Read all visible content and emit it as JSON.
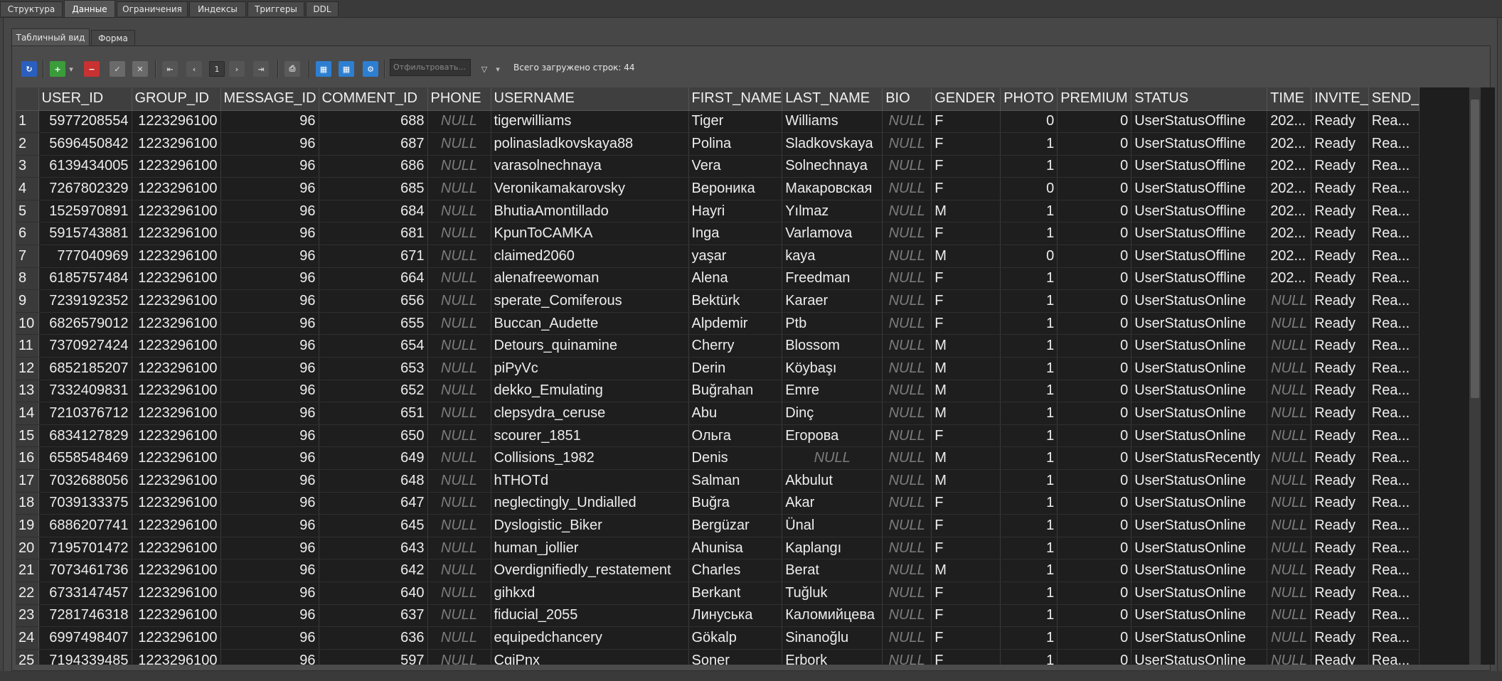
{
  "top_tabs": [
    "Структура",
    "Данные",
    "Ограничения",
    "Индексы",
    "Триггеры",
    "DDL"
  ],
  "sub_tabs": [
    "Табличный вид",
    "Форма"
  ],
  "toolbar": {
    "page_number": "1",
    "filter_placeholder": "Отфильтровать...",
    "row_count_label": "Всего загружено строк: 44"
  },
  "colors": {
    "background": "#434343",
    "grid_bg": "#1e1e1e",
    "header_bg": "#3f3f3f",
    "null_text": "#7d7d7d"
  },
  "grid": {
    "columns": [
      "USER_ID",
      "GROUP_ID",
      "MESSAGE_ID",
      "COMMENT_ID",
      "PHONE",
      "USERNAME",
      "FIRST_NAME",
      "LAST_NAME",
      "BIO",
      "GENDER",
      "PHOTO",
      "PREMIUM",
      "STATUS",
      "TIME",
      "INVITE_",
      "SEND_"
    ],
    "rows": [
      [
        "1",
        "5977208554",
        "1223296100",
        "96",
        "688",
        "NULL",
        "tigerwilliams",
        "Tiger",
        "Williams",
        "NULL",
        "F",
        "0",
        "0",
        "UserStatusOffline",
        "202...",
        "Ready",
        "Rea..."
      ],
      [
        "2",
        "5696450842",
        "1223296100",
        "96",
        "687",
        "NULL",
        "polinasladkovskaya88",
        "Polina",
        "Sladkovskaya",
        "NULL",
        "F",
        "1",
        "0",
        "UserStatusOffline",
        "202...",
        "Ready",
        "Rea..."
      ],
      [
        "3",
        "6139434005",
        "1223296100",
        "96",
        "686",
        "NULL",
        "varasolnechnaya",
        "Vera",
        "Solnechnaya",
        "NULL",
        "F",
        "1",
        "0",
        "UserStatusOffline",
        "202...",
        "Ready",
        "Rea..."
      ],
      [
        "4",
        "7267802329",
        "1223296100",
        "96",
        "685",
        "NULL",
        "Veronikamakarovsky",
        "Вероника",
        "Макаровская",
        "NULL",
        "F",
        "0",
        "0",
        "UserStatusOffline",
        "202...",
        "Ready",
        "Rea..."
      ],
      [
        "5",
        "1525970891",
        "1223296100",
        "96",
        "684",
        "NULL",
        "BhutiaAmontillado",
        "Hayri",
        "Yılmaz",
        "NULL",
        "M",
        "1",
        "0",
        "UserStatusOffline",
        "202...",
        "Ready",
        "Rea..."
      ],
      [
        "6",
        "5915743881",
        "1223296100",
        "96",
        "681",
        "NULL",
        "KpunToCAMKA",
        "Inga",
        "Varlamova",
        "NULL",
        "F",
        "1",
        "0",
        "UserStatusOffline",
        "202...",
        "Ready",
        "Rea..."
      ],
      [
        "7",
        "777040969",
        "1223296100",
        "96",
        "671",
        "NULL",
        "claimed2060",
        "yaşar",
        "kaya",
        "NULL",
        "M",
        "0",
        "0",
        "UserStatusOffline",
        "202...",
        "Ready",
        "Rea..."
      ],
      [
        "8",
        "6185757484",
        "1223296100",
        "96",
        "664",
        "NULL",
        "alenafreewoman",
        "Alena",
        "Freedman",
        "NULL",
        "F",
        "1",
        "0",
        "UserStatusOffline",
        "202...",
        "Ready",
        "Rea..."
      ],
      [
        "9",
        "7239192352",
        "1223296100",
        "96",
        "656",
        "NULL",
        "sperate_Comiferous",
        "Bektürk",
        "Karaer",
        "NULL",
        "F",
        "1",
        "0",
        "UserStatusOnline",
        "NULL",
        "Ready",
        "Rea..."
      ],
      [
        "10",
        "6826579012",
        "1223296100",
        "96",
        "655",
        "NULL",
        "Buccan_Audette",
        "Alpdemir",
        "Ptb",
        "NULL",
        "F",
        "1",
        "0",
        "UserStatusOnline",
        "NULL",
        "Ready",
        "Rea..."
      ],
      [
        "11",
        "7370927424",
        "1223296100",
        "96",
        "654",
        "NULL",
        "Detours_quinamine",
        "Cherry",
        "Blossom",
        "NULL",
        "M",
        "1",
        "0",
        "UserStatusOnline",
        "NULL",
        "Ready",
        "Rea..."
      ],
      [
        "12",
        "6852185207",
        "1223296100",
        "96",
        "653",
        "NULL",
        "piPyVc",
        "Derin",
        "Köybaşı",
        "NULL",
        "M",
        "1",
        "0",
        "UserStatusOnline",
        "NULL",
        "Ready",
        "Rea..."
      ],
      [
        "13",
        "7332409831",
        "1223296100",
        "96",
        "652",
        "NULL",
        "dekko_Emulating",
        "Buğrahan",
        "Emre",
        "NULL",
        "M",
        "1",
        "0",
        "UserStatusOnline",
        "NULL",
        "Ready",
        "Rea..."
      ],
      [
        "14",
        "7210376712",
        "1223296100",
        "96",
        "651",
        "NULL",
        "clepsydra_ceruse",
        "Abu",
        "Dinç",
        "NULL",
        "M",
        "1",
        "0",
        "UserStatusOnline",
        "NULL",
        "Ready",
        "Rea..."
      ],
      [
        "15",
        "6834127829",
        "1223296100",
        "96",
        "650",
        "NULL",
        "scourer_1851",
        "Ольга",
        "Егорова",
        "NULL",
        "F",
        "1",
        "0",
        "UserStatusOnline",
        "NULL",
        "Ready",
        "Rea..."
      ],
      [
        "16",
        "6558548469",
        "1223296100",
        "96",
        "649",
        "NULL",
        "Collisions_1982",
        "Denis",
        "NULL",
        "NULL",
        "M",
        "1",
        "0",
        "UserStatusRecently",
        "NULL",
        "Ready",
        "Rea..."
      ],
      [
        "17",
        "7032688056",
        "1223296100",
        "96",
        "648",
        "NULL",
        "hTHOTd",
        "Salman",
        "Akbulut",
        "NULL",
        "M",
        "1",
        "0",
        "UserStatusOnline",
        "NULL",
        "Ready",
        "Rea..."
      ],
      [
        "18",
        "7039133375",
        "1223296100",
        "96",
        "647",
        "NULL",
        "neglectingly_Undialled",
        "Buğra",
        "Akar",
        "NULL",
        "F",
        "1",
        "0",
        "UserStatusOnline",
        "NULL",
        "Ready",
        "Rea..."
      ],
      [
        "19",
        "6886207741",
        "1223296100",
        "96",
        "645",
        "NULL",
        "Dyslogistic_Biker",
        "Bergüzar",
        "Ünal",
        "NULL",
        "F",
        "1",
        "0",
        "UserStatusOnline",
        "NULL",
        "Ready",
        "Rea..."
      ],
      [
        "20",
        "7195701472",
        "1223296100",
        "96",
        "643",
        "NULL",
        "human_jollier",
        "Ahunisa",
        "Kaplangı",
        "NULL",
        "F",
        "1",
        "0",
        "UserStatusOnline",
        "NULL",
        "Ready",
        "Rea..."
      ],
      [
        "21",
        "7073461736",
        "1223296100",
        "96",
        "642",
        "NULL",
        "Overdignifiedly_restatement",
        "Charles",
        "Berat",
        "NULL",
        "M",
        "1",
        "0",
        "UserStatusOnline",
        "NULL",
        "Ready",
        "Rea..."
      ],
      [
        "22",
        "6733147457",
        "1223296100",
        "96",
        "640",
        "NULL",
        "gihkxd",
        "Berkant",
        "Tuğluk",
        "NULL",
        "F",
        "1",
        "0",
        "UserStatusOnline",
        "NULL",
        "Ready",
        "Rea..."
      ],
      [
        "23",
        "7281746318",
        "1223296100",
        "96",
        "637",
        "NULL",
        "fiducial_2055",
        "Линуська",
        "Каломийцева",
        "NULL",
        "F",
        "1",
        "0",
        "UserStatusOnline",
        "NULL",
        "Ready",
        "Rea..."
      ],
      [
        "24",
        "6997498407",
        "1223296100",
        "96",
        "636",
        "NULL",
        "equipedchancery",
        "Gökalp",
        "Sinanoğlu",
        "NULL",
        "F",
        "1",
        "0",
        "UserStatusOnline",
        "NULL",
        "Ready",
        "Rea..."
      ],
      [
        "25",
        "7194339485",
        "1223296100",
        "96",
        "597",
        "NULL",
        "CgiPnx",
        "Soner",
        "Erbork",
        "NULL",
        "F",
        "1",
        "0",
        "UserStatusOnline",
        "NULL",
        "Ready",
        "Rea..."
      ]
    ]
  }
}
